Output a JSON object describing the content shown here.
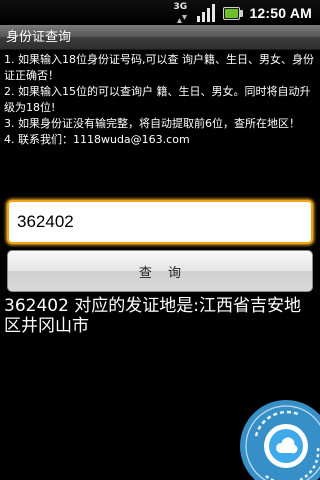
{
  "status_bar": {
    "network_type": "3G",
    "time": "12:50 AM",
    "icons": [
      "3g-data-icon",
      "signal-strength-icon",
      "battery-icon"
    ]
  },
  "app": {
    "title": "身份证查询"
  },
  "instructions": [
    "1. 如果输入18位身份证号码,可以查 询户籍、生日、男女、身份证正确否！",
    "2. 如果输入15位的可以查询户 籍、生日、男女。同时将自动升级为18位!",
    "3. 如果身份证没有输完整，将自动提取前6位，查所在地区！",
    "4. 联系我们：1118wuda@163.com"
  ],
  "input": {
    "value": "362402"
  },
  "query_button": {
    "label": "查 询"
  },
  "result": {
    "text": "362402  对应的发证地是:江西省吉安地区井冈山市"
  },
  "colors": {
    "background": "#000000",
    "input_focus": "#f2a318",
    "watermark": "#3fa9ea"
  }
}
